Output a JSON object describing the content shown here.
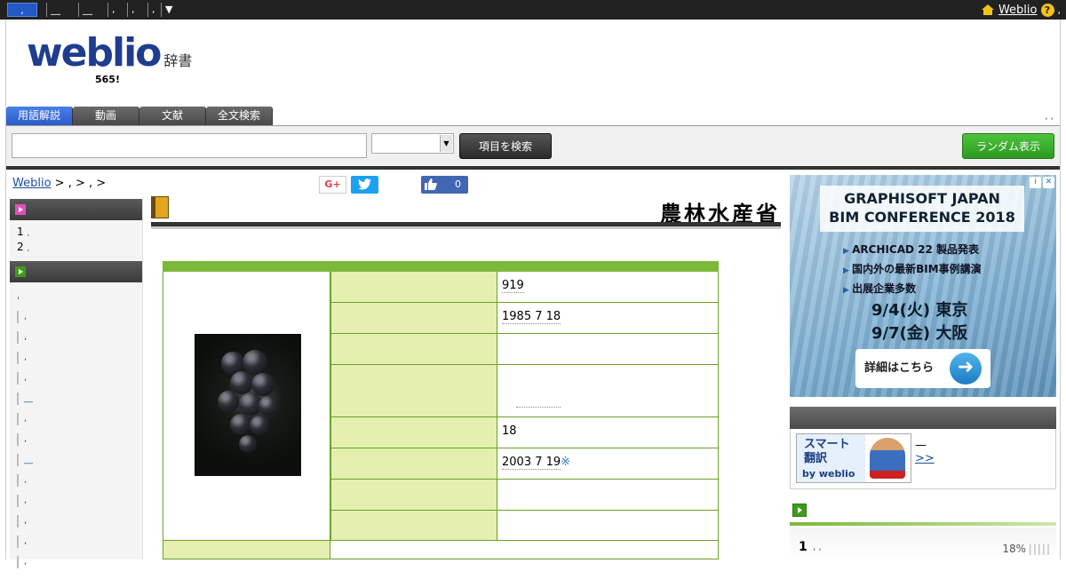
{
  "topbar": {
    "tabs": [
      ",",
      "__",
      "__",
      ",",
      ",",
      ",",
      "▼"
    ],
    "right_link": "Weblio",
    "help": "?",
    "trailing": ","
  },
  "header": {
    "logo": "weblio",
    "logo_sub": "辞書",
    "count": "565!",
    "tabs": [
      "用語解説",
      "動画",
      "文献",
      "全文検索"
    ],
    "tab_right": ", ,"
  },
  "search": {
    "placeholder": "",
    "button": "項目を検索",
    "random": "ランダム表示"
  },
  "breadcrumb": {
    "home": "Weblio",
    "rest": " > , > , >"
  },
  "social": {
    "gplus": "G+",
    "like_count": "0"
  },
  "sidebar": {
    "list": [
      {
        "num": "1",
        "text": ","
      },
      {
        "num": "2",
        "text": ","
      }
    ],
    "links": [
      ",",
      ",",
      ",",
      ",",
      ",",
      "__",
      ",",
      ",",
      "__",
      ",",
      ",",
      ",",
      ",",
      ","
    ]
  },
  "main": {
    "title": "農林水産省",
    "rows": [
      {
        "value": "919"
      },
      {
        "value": "1985 7 18"
      },
      {
        "value": ""
      },
      {
        "value": ""
      },
      {
        "value": "18"
      },
      {
        "value": "2003 7 19",
        "mark": "※"
      },
      {
        "value": ""
      },
      {
        "value": ""
      }
    ]
  },
  "ad": {
    "headline1": "GRAPHISOFT JAPAN",
    "headline2": "BIM CONFERENCE 2018",
    "items": [
      "ARCHICAD 22 製品発表",
      "国内外の最新BIM事例講演",
      "出展企業多数"
    ],
    "date1": "9/4(火) 東京",
    "date2": "9/7(金) 大阪",
    "cta": "詳細はこちら"
  },
  "right": {
    "translate_line1": "スマート",
    "translate_line2": "翻訳",
    "translate_by": "by weblio",
    "text1": "—",
    "text2": ">>",
    "rank_num": "1",
    "rank_text": ", ,",
    "rank_pct": "18%",
    "rank_bars": "|||||"
  },
  "colors": {
    "accent": "#2359c4",
    "green": "#7cb83a",
    "dark": "#222222"
  }
}
